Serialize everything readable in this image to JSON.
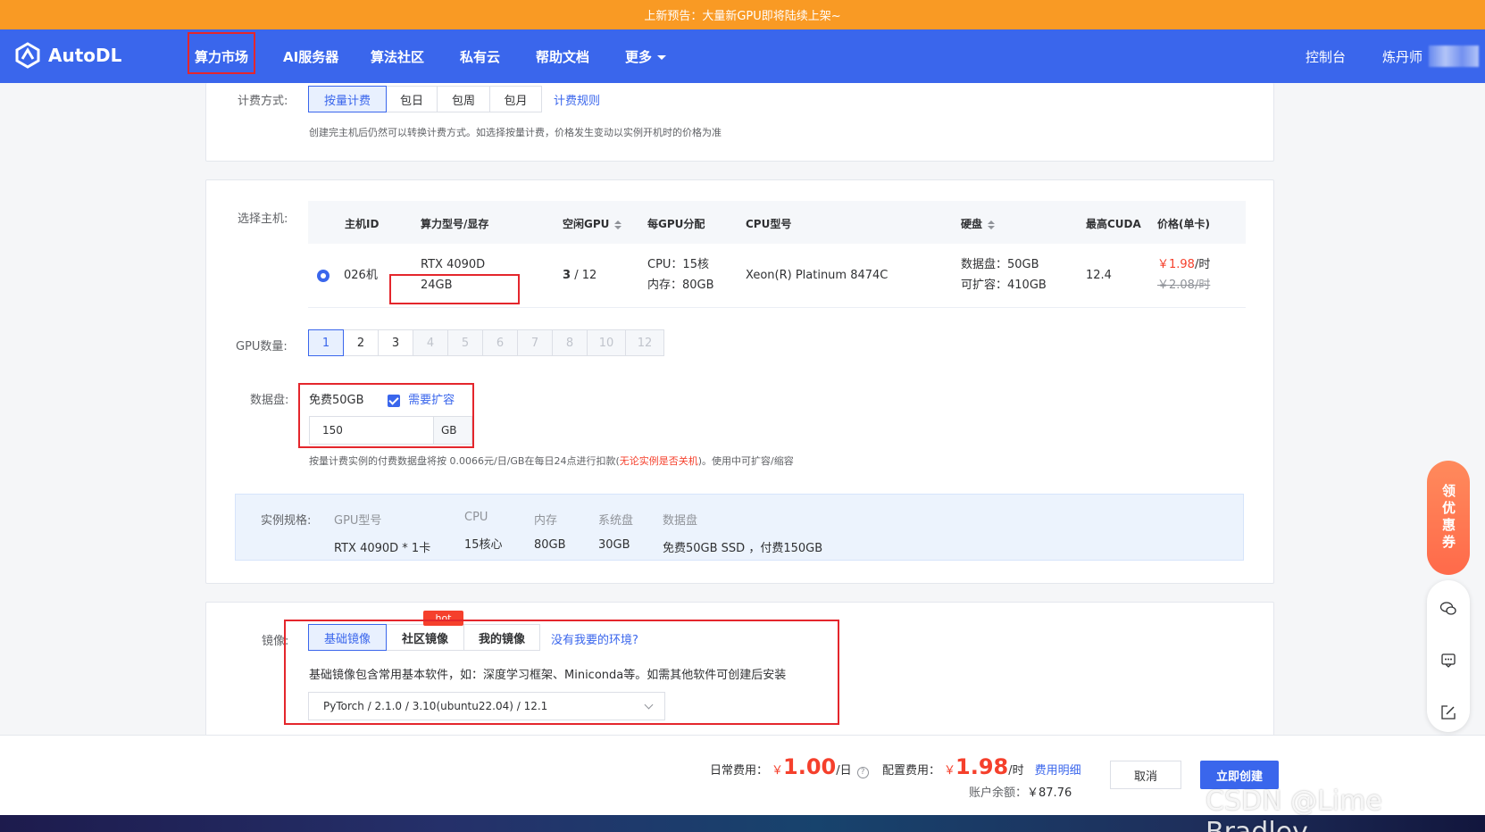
{
  "banner": {
    "text": "上新预告：大量新GPU即将陆续上架~"
  },
  "nav": {
    "brand": "AutoDL",
    "items": [
      "算力市场",
      "AI服务器",
      "算法社区",
      "私有云",
      "帮助文档",
      "更多"
    ],
    "right": [
      "控制台",
      "炼丹师"
    ]
  },
  "billing": {
    "label": "计费方式:",
    "options": [
      "按量计费",
      "包日",
      "包周",
      "包月"
    ],
    "selected": "按量计费",
    "rules_link": "计费规则",
    "hint": "创建完主机后仍然可以转换计费方式。如选择按量计费，价格发生变动以实例开机时的价格为准"
  },
  "host": {
    "label": "选择主机:",
    "columns": [
      "主机ID",
      "算力型号/显存",
      "空闲GPU",
      "每GPU分配",
      "CPU型号",
      "硬盘",
      "最高CUDA",
      "价格(单卡)"
    ],
    "row": {
      "id": "026机",
      "model": "RTX 4090D",
      "vram": "24GB",
      "free_gpu": "3",
      "total_gpu": "/ 12",
      "cpu_alloc": "CPU：15核",
      "mem_alloc": "内存：80GB",
      "cpu_model": "Xeon(R) Platinum 8474C",
      "disk_data": "数据盘：50GB",
      "disk_expand": "可扩容：410GB",
      "cuda": "12.4",
      "price": "￥1.98",
      "price_unit": "/时",
      "price_old": "￥2.08/时"
    }
  },
  "gpu_count": {
    "label": "GPU数量:",
    "options": [
      "1",
      "2",
      "3",
      "4",
      "5",
      "6",
      "7",
      "8",
      "10",
      "12"
    ],
    "selected": "1",
    "enabled_max": 3
  },
  "data_disk": {
    "label": "数据盘:",
    "free": "免费50GB",
    "expand_label": "需要扩容",
    "expand_checked": true,
    "value": "150",
    "unit": "GB",
    "hint_prefix": "按量计费实例的付费数据盘将按 0.0066元/日/GB在每日24点进行扣款(",
    "hint_red": "无论实例是否关机",
    "hint_suffix": ")。使用中可扩容/缩容"
  },
  "spec": {
    "label": "实例规格:",
    "cols": [
      {
        "k": "GPU型号",
        "v": "RTX 4090D * 1卡"
      },
      {
        "k": "CPU",
        "v": "15核心"
      },
      {
        "k": "内存",
        "v": "80GB"
      },
      {
        "k": "系统盘",
        "v": "30GB"
      },
      {
        "k": "数据盘",
        "v": "免费50GB SSD ，付费150GB"
      }
    ]
  },
  "image": {
    "label": "镜像:",
    "tabs": [
      "基础镜像",
      "社区镜像",
      "我的镜像"
    ],
    "selected": "基础镜像",
    "hot": "hot",
    "missing_link": "没有我要的环境?",
    "desc": "基础镜像包含常用基本软件，如：深度学习框架、Miniconda等。如需其他软件可创建后安装",
    "selected_value": "PyTorch / 2.1.0 / 3.10(ubuntu22.04) / 12.1"
  },
  "footer": {
    "daily_label": "日常费用：",
    "daily_currency": "￥",
    "daily_value": "1.00",
    "daily_unit": "/日",
    "config_label": "配置费用：",
    "config_currency": "￥",
    "config_value": "1.98",
    "config_unit": "/时",
    "detail_link": "费用明细",
    "balance_label": "账户余额：",
    "balance": "￥87.76",
    "cancel": "取消",
    "create": "立即创建"
  },
  "coupon": {
    "text": "领优惠券"
  },
  "watermark": "CSDN @Lime Bradley",
  "colors": {
    "brand": "#3a66ec",
    "banner": "#f99a24",
    "price": "#f5402c",
    "highlight": "#e4262c"
  }
}
